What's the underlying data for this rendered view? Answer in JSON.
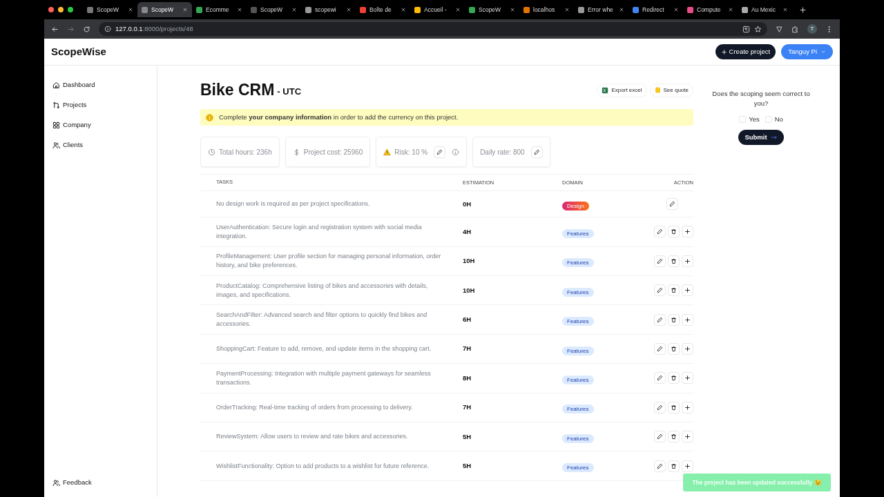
{
  "browser": {
    "tabs": [
      {
        "title": "ScopeW",
        "selected": false
      },
      {
        "title": "ScopeW",
        "selected": true
      },
      {
        "title": "Ecomme",
        "selected": false
      },
      {
        "title": "ScopeW",
        "selected": false
      },
      {
        "title": "scopewi",
        "selected": false
      },
      {
        "title": "Boîte de",
        "selected": false
      },
      {
        "title": "Accueil -",
        "selected": false
      },
      {
        "title": "ScopeW",
        "selected": false
      },
      {
        "title": "localhos",
        "selected": false
      },
      {
        "title": "Error whe",
        "selected": false
      },
      {
        "title": "Redirect",
        "selected": false
      },
      {
        "title": "Compute",
        "selected": false
      },
      {
        "title": "Au Mexic",
        "selected": false
      }
    ],
    "url_host": "127.0.0.1",
    "url_path": ":8000/projects/48",
    "profile_initial": "T"
  },
  "app": {
    "brand": "ScopeWise",
    "create_button": "Create project",
    "user_menu": "Tanguy Pi"
  },
  "sidebar": {
    "items": [
      {
        "label": "Dashboard",
        "kind": "home"
      },
      {
        "label": "Projects",
        "kind": "projects"
      },
      {
        "label": "Company",
        "kind": "grid"
      },
      {
        "label": "Clients",
        "kind": "users"
      }
    ],
    "footer": "Feedback"
  },
  "project": {
    "title": "Bike CRM",
    "timezone": "- UTC",
    "actions": [
      {
        "label": "Export excel",
        "kind": "excel"
      },
      {
        "label": "See quote",
        "kind": "quote"
      }
    ],
    "alert": "Complete **your company information** in order to add the currency on this project.",
    "stats": [
      {
        "text": "Total hours: 236h",
        "kind": "hours"
      },
      {
        "text": "Project cost: 25960",
        "kind": "cost"
      },
      {
        "text": "Risk: 10 %",
        "kind": "risk"
      },
      {
        "text": "Daily rate: 800",
        "kind": "rate"
      }
    ]
  },
  "table": {
    "columns": [
      "TASKS",
      "ESTIMATION",
      "DOMAIN",
      "ACTION"
    ],
    "rows": [
      {
        "task": "No design work is required as per project specifications.",
        "estimation": "0H",
        "domain": "Design",
        "kind": "design"
      },
      {
        "task": "UserAuthentication: Secure login and registration system with social media integration.",
        "estimation": "4H",
        "domain": "Features",
        "kind": "features"
      },
      {
        "task": "ProfileManagement: User profile section for managing personal information, order history, and bike preferences.",
        "estimation": "10H",
        "domain": "Features",
        "kind": "features"
      },
      {
        "task": "ProductCatalog: Comprehensive listing of bikes and accessories with details, images, and specifications.",
        "estimation": "10H",
        "domain": "Features",
        "kind": "features"
      },
      {
        "task": "SearchAndFilter: Advanced search and filter options to quickly find bikes and accessories.",
        "estimation": "6H",
        "domain": "Features",
        "kind": "features"
      },
      {
        "task": "ShoppingCart: Feature to add, remove, and update items in the shopping cart.",
        "estimation": "7H",
        "domain": "Features",
        "kind": "features"
      },
      {
        "task": "PaymentProcessing: Integration with multiple payment gateways for seamless transactions.",
        "estimation": "8H",
        "domain": "Features",
        "kind": "features"
      },
      {
        "task": "OrderTracking: Real-time tracking of orders from processing to delivery.",
        "estimation": "7H",
        "domain": "Features",
        "kind": "features"
      },
      {
        "task": "ReviewSystem: Allow users to review and rate bikes and accessories.",
        "estimation": "5H",
        "domain": "Features",
        "kind": "features"
      },
      {
        "task": "WishlistFunctionality: Option to add products to a wishlist for future reference.",
        "estimation": "5H",
        "domain": "Features",
        "kind": "features"
      }
    ]
  },
  "feedback": {
    "question": "Does the scoping seem correct to you?",
    "options": [
      {
        "label": "Yes",
        "checked": false
      },
      {
        "label": "No",
        "checked": false
      }
    ],
    "submit": "Submit"
  },
  "toast": "The project has been updated successfully 😉"
}
